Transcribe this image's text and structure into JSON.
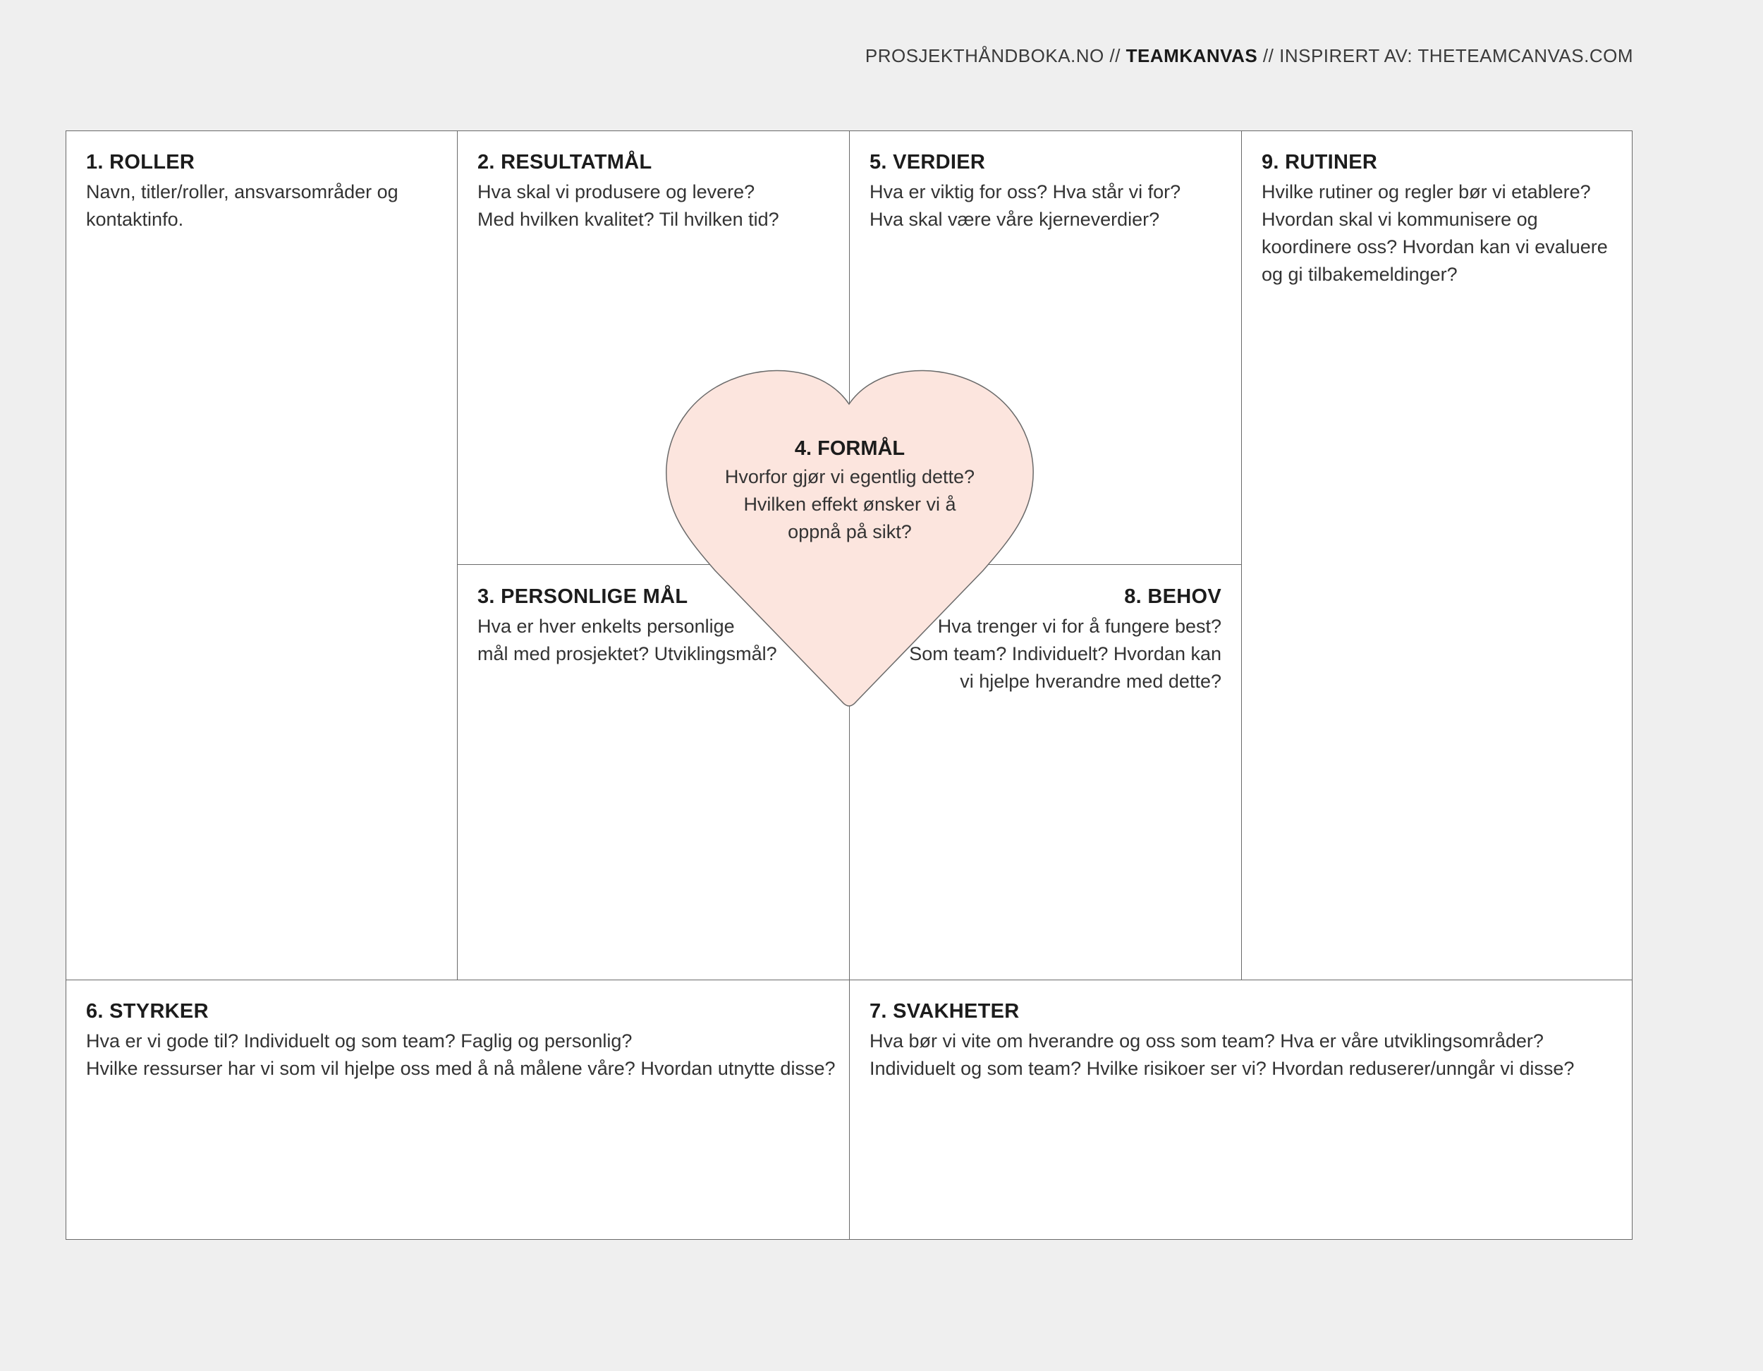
{
  "header": {
    "prefix": "PROSJEKTHÅNDBOKA.NO // ",
    "title": "TEAMKANVAS",
    "suffix": " // INSPIRERT AV: THETEAMCANVAS.COM"
  },
  "sections": {
    "roller": {
      "title": "1. ROLLER",
      "text": "Navn, titler/roller, ansvarsområder og\nkontaktinfo."
    },
    "resultatmal": {
      "title": "2. RESULTATMÅL",
      "text": "Hva skal vi produsere og levere?\nMed hvilken kvalitet? Til hvilken tid?"
    },
    "personlige_mal": {
      "title": "3. PERSONLIGE MÅL",
      "text": "Hva er hver enkelts personlige\nmål med prosjektet? Utviklingsmål?"
    },
    "formal": {
      "title": "4. FORMÅL",
      "text": "Hvorfor gjør vi egentlig dette?\nHvilken effekt ønsker vi å\noppnå på sikt?"
    },
    "verdier": {
      "title": "5. VERDIER",
      "text": "Hva er viktig for oss? Hva står vi for?\nHva skal være våre kjerneverdier?"
    },
    "styrker": {
      "title": "6. STYRKER",
      "text": "Hva er vi gode til? Individuelt og som team? Faglig og personlig?\nHvilke ressurser har vi som vil hjelpe oss med å nå målene våre? Hvordan utnytte disse?"
    },
    "svakheter": {
      "title": "7. SVAKHETER",
      "text": "Hva bør vi vite om hverandre og oss som team? Hva er våre utviklingsområder?\nIndividuelt og som team? Hvilke risikoer ser vi? Hvordan reduserer/unngår vi disse?"
    },
    "behov": {
      "title": "8. BEHOV",
      "text": "Hva trenger vi for å fungere best?\nSom team? Individuelt? Hvordan kan\nvi hjelpe hverandre med dette?"
    },
    "rutiner": {
      "title": "9. RUTINER",
      "text": "Hvilke rutiner og regler bør vi etablere?\nHvordan skal vi kommunisere og\nkoordinere oss? Hvordan kan vi evaluere\nog gi tilbakemeldinger?"
    }
  },
  "colors": {
    "heart_fill": "#fce5de",
    "lines": "#6a6a6a",
    "background": "#efefef"
  }
}
